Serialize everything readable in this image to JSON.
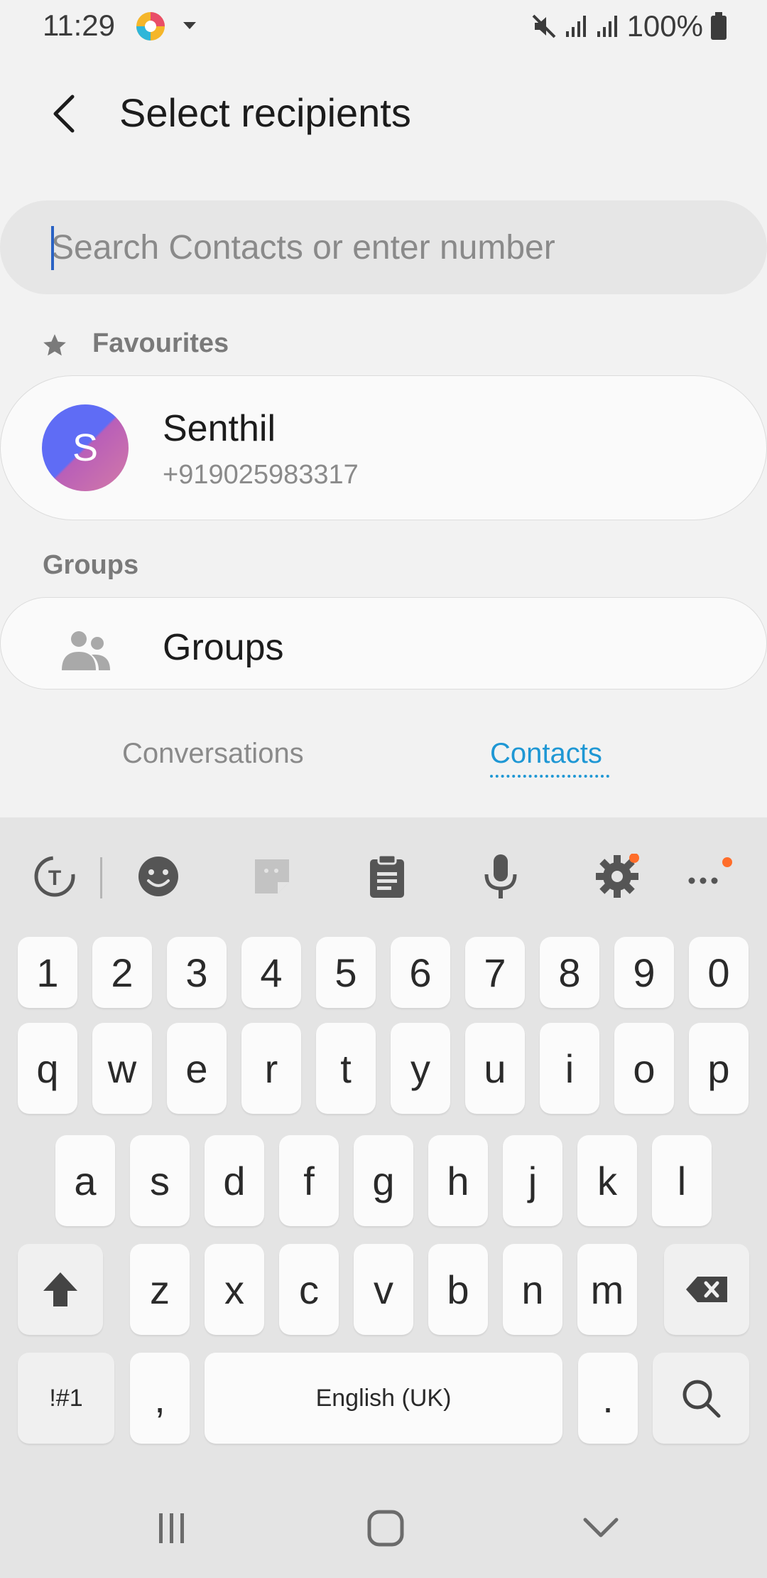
{
  "status_bar": {
    "time": "11:29",
    "battery": "100%",
    "icons": [
      "app-icon",
      "mute-icon",
      "signal-icon",
      "signal-icon",
      "battery-icon"
    ]
  },
  "header": {
    "title": "Select recipients",
    "back_icon": "back-arrow-icon"
  },
  "search": {
    "placeholder": "Search Contacts or enter number",
    "value": ""
  },
  "favourites": {
    "label": "Favourites",
    "contacts": [
      {
        "initial": "S",
        "name": "Senthil",
        "number": "+919025983317"
      }
    ]
  },
  "groups": {
    "section_label": "Groups",
    "item_label": "Groups"
  },
  "tabs": {
    "conversations": "Conversations",
    "contacts": "Contacts",
    "active": "Contacts"
  },
  "keyboard": {
    "toolbar": [
      "translate-icon",
      "emoji-icon",
      "sticker-icon",
      "clipboard-icon",
      "microphone-icon",
      "settings-icon",
      "more-icon"
    ],
    "number_row": [
      "1",
      "2",
      "3",
      "4",
      "5",
      "6",
      "7",
      "8",
      "9",
      "0"
    ],
    "row1": [
      "q",
      "w",
      "e",
      "r",
      "t",
      "y",
      "u",
      "i",
      "o",
      "p"
    ],
    "row2": [
      "a",
      "s",
      "d",
      "f",
      "g",
      "h",
      "j",
      "k",
      "l"
    ],
    "row3": [
      "z",
      "x",
      "c",
      "v",
      "b",
      "n",
      "m"
    ],
    "symbols_key": "!#1",
    "comma_key": ",",
    "space_label": "English (UK)",
    "period_key": ".",
    "accent_color": "#ff6d2a"
  },
  "colors": {
    "accent": "#1e97d4",
    "background": "#f2f2f2"
  }
}
